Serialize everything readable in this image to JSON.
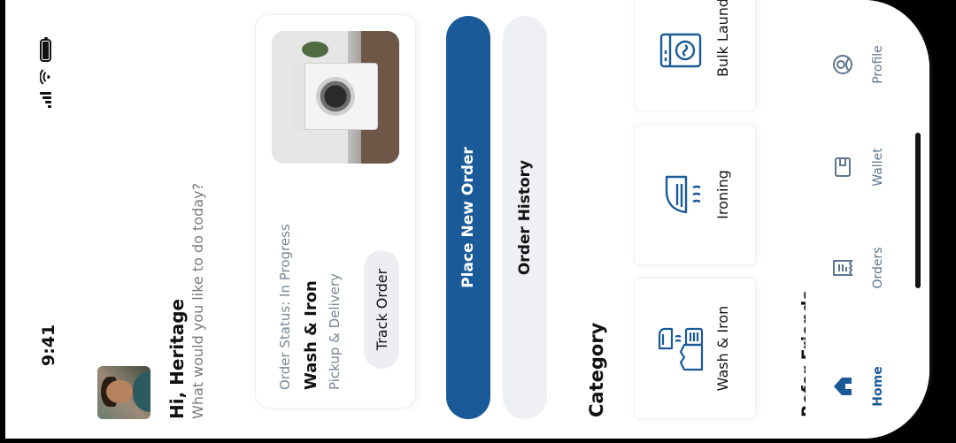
{
  "status_bar": {
    "time": "9:41"
  },
  "header": {
    "greeting": "Hi, Heritage",
    "subtitle": "What would you like to do today?"
  },
  "order_card": {
    "status": "Order Status: In Progress",
    "service": "Wash & Iron",
    "delivery": "Pickup & Delivery",
    "track_label": "Track Order"
  },
  "actions": {
    "primary_label": "Place New Order",
    "secondary_label": "Order History"
  },
  "category": {
    "title": "Category",
    "items": [
      {
        "label": "Wash & Iron",
        "icon": "wash-iron-icon"
      },
      {
        "label": "Ironing",
        "icon": "iron-icon"
      },
      {
        "label": "Bulk Laundry",
        "icon": "bulk-laundry-icon"
      }
    ]
  },
  "refer": {
    "title": "Refer Friends"
  },
  "nav": {
    "items": [
      {
        "label": "Home",
        "icon": "home-icon",
        "active": true
      },
      {
        "label": "Orders",
        "icon": "orders-icon",
        "active": false
      },
      {
        "label": "Wallet",
        "icon": "wallet-icon",
        "active": false
      },
      {
        "label": "Profile",
        "icon": "profile-icon",
        "active": false
      }
    ]
  },
  "colors": {
    "primary": "#1b5a99",
    "muted_text": "#7a8694",
    "secondary_button": "#eef0f4"
  }
}
